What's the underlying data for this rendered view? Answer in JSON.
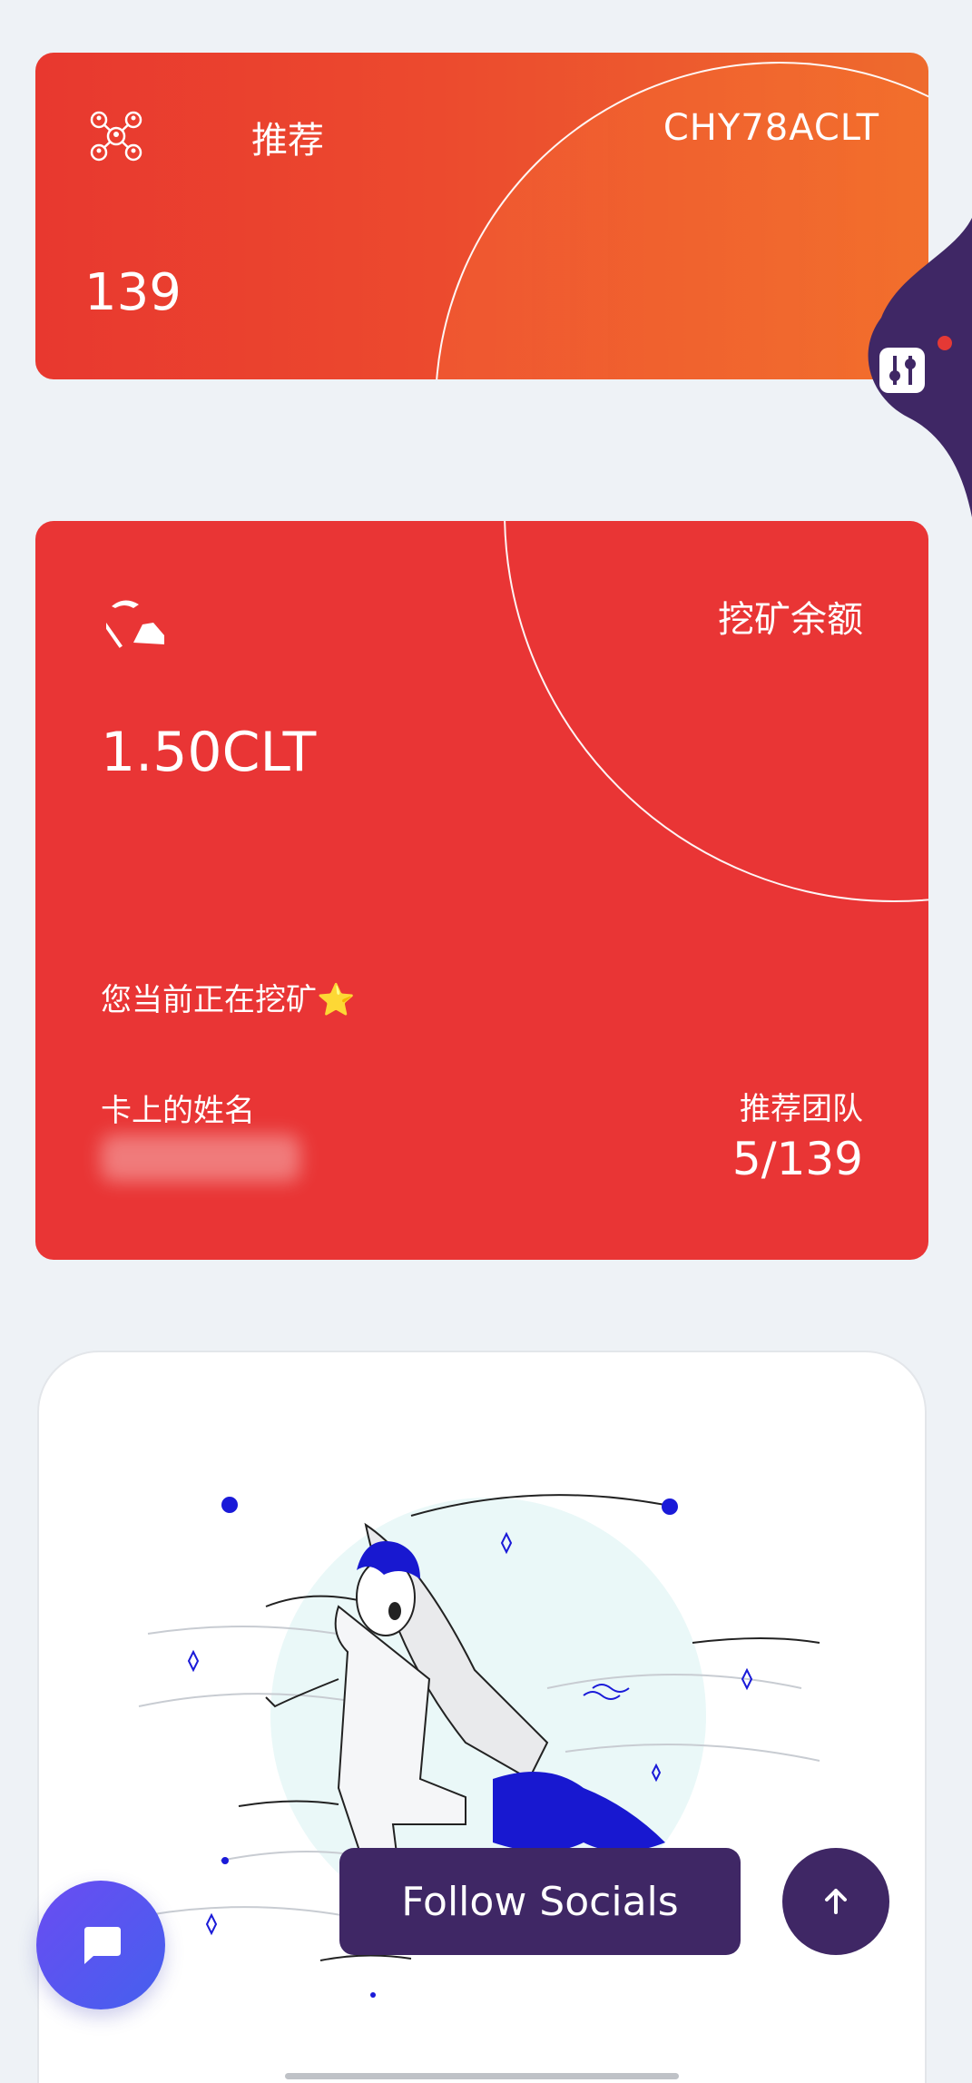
{
  "referral": {
    "title": "推荐",
    "code": "CHY78ACLT",
    "count": "139"
  },
  "mining": {
    "label": "挖矿余额",
    "balance": "1.50CLT",
    "status": "您当前正在挖矿⭐",
    "name_label": "卡上的姓名",
    "team_label": "推荐团队",
    "team_value": "5/139"
  },
  "actions": {
    "follow_label": "Follow Socials"
  },
  "colors": {
    "referral_start": "#e8382f",
    "referral_end": "#ee6b2d",
    "mining_bg": "#e93535",
    "button_dark": "#3f2765",
    "chat_gradient_start": "#6a4cf2",
    "chat_gradient_end": "#4560ee"
  },
  "icons": {
    "referral": "network-icon",
    "mining": "pickaxe-icon",
    "side": "settings-sliders-icon",
    "chat": "chat-bubble-icon",
    "up": "arrow-up-icon"
  }
}
